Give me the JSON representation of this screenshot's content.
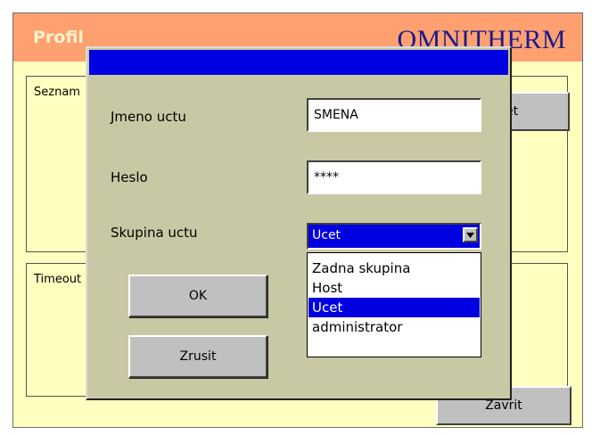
{
  "window": {
    "app_title": "Profil",
    "brand": "OMNITHERM"
  },
  "background": {
    "accounts_panel_label": "Seznam",
    "timeout_panel_label": "Timeout",
    "right_button_label": "et",
    "close_button_label": "Zavrit"
  },
  "dialog": {
    "title": "",
    "account_name": {
      "label": "Jmeno uctu",
      "value": "SMENA"
    },
    "password": {
      "label": "Heslo",
      "value": "****"
    },
    "group": {
      "label": "Skupina uctu",
      "selected": "Ucet",
      "options": [
        "Zadna skupina",
        "Host",
        "Ucet",
        "administrator"
      ],
      "highlighted_index": 2
    },
    "ok_label": "OK",
    "cancel_label": "Zrusit"
  },
  "colors": {
    "header": "#ffa070",
    "background": "#ffffc0",
    "dialog": "#c9c8a4",
    "selection": "#0000e0",
    "brand_text": "#1a1a8c"
  }
}
